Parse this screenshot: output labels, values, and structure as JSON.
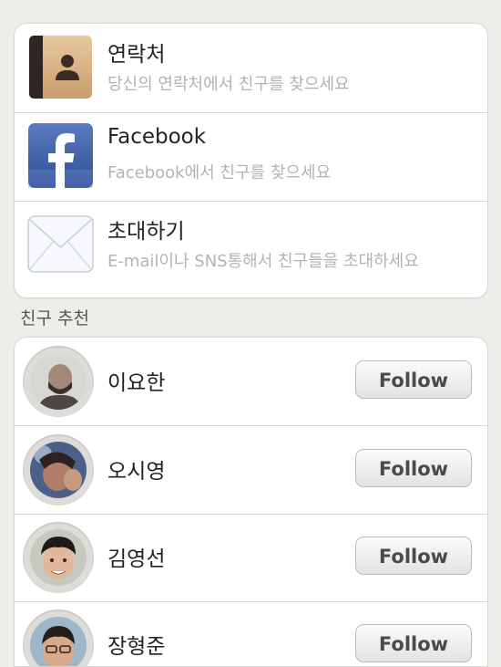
{
  "invite_options": [
    {
      "title": "연락처",
      "subtitle": "당신의 연락처에서 친구를 찾으세요",
      "icon": "address-book-icon"
    },
    {
      "title": "Facebook",
      "subtitle": "Facebook에서 친구를 찾으세요",
      "icon": "facebook-icon"
    },
    {
      "title": "초대하기",
      "subtitle": "E-mail이나 SNS통해서 친구들을 초대하세요",
      "icon": "envelope-icon"
    }
  ],
  "recommendations": {
    "section_title": "친구 추천",
    "follow_label": "Follow",
    "friends": [
      {
        "name": "이요한",
        "avatar": "avatar-photo"
      },
      {
        "name": "오시영",
        "avatar": "avatar-photo"
      },
      {
        "name": "김영선",
        "avatar": "avatar-photo"
      },
      {
        "name": "장형준",
        "avatar": "avatar-photo"
      }
    ]
  },
  "colors": {
    "background": "#efedea",
    "facebook_blue": "#3b5998"
  }
}
